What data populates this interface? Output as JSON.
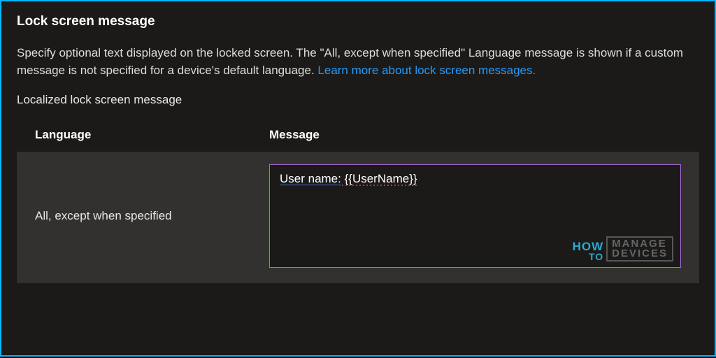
{
  "title": "Lock screen message",
  "description": {
    "text_before_link": "Specify optional text displayed on the locked screen. The \"All, except when specified\" Language message is shown if a custom message is not specified for a device's default language. ",
    "link_text": "Learn more about lock screen messages."
  },
  "subheading": "Localized lock screen message",
  "table": {
    "headers": {
      "language": "Language",
      "message": "Message"
    },
    "rows": [
      {
        "language": "All, except when specified",
        "message_prefix": "User name:",
        "message_value": " {{UserName}}",
        "full_message": "User name: {{UserName}}"
      }
    ]
  },
  "watermark": {
    "how": "HOW",
    "to": "TO",
    "manage": "MANAGE",
    "devices": "DEVICES"
  }
}
